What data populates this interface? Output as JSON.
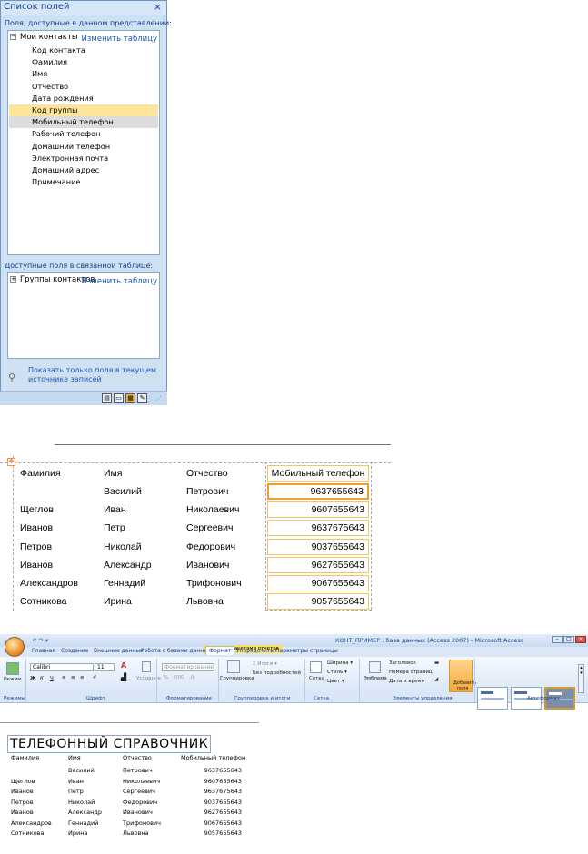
{
  "field_list": {
    "title": "Список полей",
    "close_glyph": "×",
    "available_caption": "Поля, доступные в данном представлении:",
    "group_name": "Мои контакты",
    "group_toggle": "−",
    "edit_table": "Изменить таблицу",
    "fields": [
      "Код контакта",
      "Фамилия",
      "Имя",
      "Отчество",
      "Дата рождения",
      "Код группы",
      "Мобильный телефон",
      "Рабочий телефон",
      "Домашний телефон",
      "Электронная почта",
      "Домашний адрес",
      "Примечание"
    ],
    "selected_field": "Код группы",
    "hovered_field": "Мобильный телефон",
    "related_caption": "Доступные поля в связанной таблице:",
    "related_group": "Группы контактов",
    "related_toggle": "+",
    "related_edit": "Изменить таблицу",
    "show_only": "Показать только поля в текущем источнике записей",
    "icons": [
      "form-view-icon",
      "print-preview-icon",
      "layout-view-icon",
      "design-view-icon"
    ]
  },
  "design": {
    "headers": [
      "Фамилия",
      "Имя",
      "Отчество",
      "Мобильный телефон"
    ],
    "rows": [
      [
        "",
        "Василий",
        "Петрович",
        "9637655643"
      ],
      [
        "Щеглов",
        "Иван",
        "Николаевич",
        "9607655643"
      ],
      [
        "Иванов",
        "Петр",
        "Сергеевич",
        "9637675643"
      ],
      [
        "Петров",
        "Николай",
        "Федорович",
        "9037655643"
      ],
      [
        "Иванов",
        "Александр",
        "Иванович",
        "9627655643"
      ],
      [
        "Александров",
        "Геннадий",
        "Трифонович",
        "9067655643"
      ],
      [
        "Сотникова",
        "Ирина",
        "Львовна",
        "9057655643"
      ]
    ]
  },
  "ribbon": {
    "title": "КОНТ_ПРИМЕР : база данных (Access 2007) - Microsoft Access",
    "context_tab": "Работа с макетами отчетов",
    "quick_access": "↶ ↷ ▾",
    "window_buttons": [
      "–",
      "□",
      "×"
    ],
    "tabs": [
      "Главная",
      "Создание",
      "Внешние данные",
      "Работа с базами данных",
      "Формат",
      "Упорядочить",
      "Параметры страницы"
    ],
    "active_tab": "Формат",
    "groups": [
      "Режимы",
      "Шрифт",
      "Форматирование",
      "Группировка и итоги",
      "Сетка",
      "Элементы управления",
      "Автоформат"
    ],
    "font_name": "Calibri",
    "font_size": "11",
    "buttons": {
      "view": "Режим",
      "conditional": "Условное",
      "format_combo": "Форматирование",
      "grouping": "Группировка",
      "totals": "Σ Итоги ▾",
      "hide_details": "Без подробностей",
      "grid": "Сетка",
      "width": "Ширина ▾",
      "style": "Стиль ▾",
      "color": "Цвет ▾",
      "logo": "Эмблема",
      "title_btn": "Заголовок",
      "page_numbers": "Номера страниц",
      "date_time": "Дата и время",
      "add_fields": "Добавить поля"
    },
    "font_buttons": [
      "Ж",
      "К",
      "Ч"
    ],
    "number_buttons": [
      "%",
      "000",
      ",0"
    ]
  },
  "report": {
    "title": "ТЕЛЕФОННЫЙ СПРАВОЧНИК",
    "headers": [
      "Фамилия",
      "Имя",
      "Отчество",
      "Мобильный телефон"
    ],
    "rows": [
      [
        "",
        "Василий",
        "Петрович",
        "9637655643"
      ],
      [
        "Щеглов",
        "Иван",
        "Николаевич",
        "9607655643"
      ],
      [
        "Иванов",
        "Петр",
        "Сергеевич",
        "9637675643"
      ],
      [
        "Петров",
        "Николай",
        "Федорович",
        "9037655643"
      ],
      [
        "Иванов",
        "Александр",
        "Иванович",
        "9627655643"
      ],
      [
        "Александров",
        "Геннадий",
        "Трифонович",
        "9067655643"
      ],
      [
        "Сотникова",
        "Ирина",
        "Львовна",
        "9057655643"
      ]
    ]
  }
}
